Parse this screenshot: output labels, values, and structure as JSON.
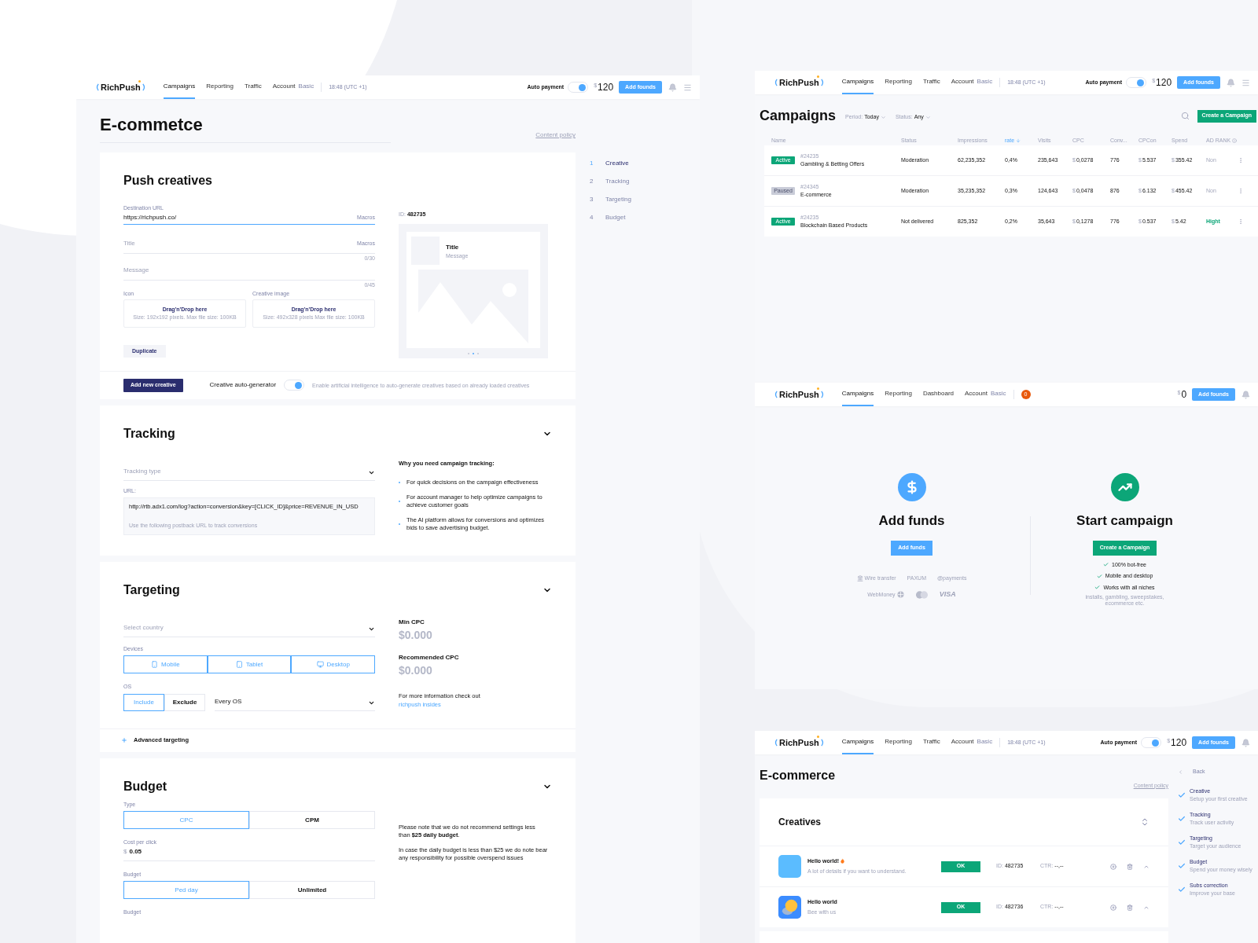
{
  "editor": {
    "nav": {
      "logo": "RichPush",
      "tabs": [
        {
          "label": "Campaigns",
          "selected": true
        },
        {
          "label": "Reporting",
          "selected": false
        },
        {
          "label": "Traffic",
          "selected": false
        },
        {
          "label": "Account",
          "selected": false
        }
      ],
      "plan": "Basic",
      "time": "18:48 (UTC +1)",
      "auto_payment": {
        "label": "Auto payment",
        "on": true
      },
      "balance": {
        "currency": "$",
        "amount": "120"
      },
      "add_button": "Add founds"
    },
    "title": "E-commetce",
    "content_policy": "Content policy",
    "steps": [
      {
        "number": "1",
        "label": "Creative",
        "selected": true
      },
      {
        "number": "2",
        "label": "Tracking",
        "selected": false
      },
      {
        "number": "3",
        "label": "Targeting",
        "selected": false
      },
      {
        "number": "4",
        "label": "Budget",
        "selected": false
      }
    ],
    "creatives": {
      "heading": "Push creatives",
      "destination": {
        "label": "Destination URL",
        "value": "https://richpush.co/",
        "macros": "Macros"
      },
      "title_field": {
        "placeholder": "Title",
        "macros": "Macros",
        "counter": "0/30"
      },
      "message_field": {
        "placeholder": "Message",
        "counter": "0/45"
      },
      "uploads": [
        {
          "label": "Icon",
          "title": "Drag'n'Drop here",
          "hint": "Size: 192x192 pixels. Max file size: 100KB"
        },
        {
          "label": "Creative image",
          "title": "Drag'n'Drop here",
          "hint": "Size: 492x328 pixels Max file size: 100KB"
        }
      ],
      "duplicate": "Duplicate",
      "preview": {
        "id_label": "ID:",
        "id": "482735",
        "title": "Title",
        "message": "Message"
      },
      "add_button": "Add new creative",
      "autogen": {
        "label": "Creative auto-generator",
        "on": true,
        "description": "Enable artificial intelligence to auto-generate creatives based on already loaded creatives"
      }
    },
    "tracking": {
      "heading": "Tracking",
      "type_placeholder": "Tracking type",
      "url_label": "URL:",
      "url": "http://rtb.adx1.com/log?action=conversion&key=[CLICK_ID]&price=REVENUE_IN_USD",
      "url_hint": "Use the following postback URL to track conversions",
      "why_title": "Why you need campaign tracking:",
      "reasons": [
        "For quick decisions on the campaign effectiveness",
        "For account manager to help optimize campaigns to achieve customer goals",
        "The AI platform allows for conversions and optimizes bids to save advertising budget."
      ]
    },
    "targeting": {
      "heading": "Targeting",
      "country_placeholder": "Select country",
      "devices_label": "Devices",
      "devices": [
        {
          "label": "Mobile",
          "kind": "mobile",
          "selected": true
        },
        {
          "label": "Tablet",
          "kind": "tablet",
          "selected": true
        },
        {
          "label": "Desktop",
          "kind": "desktop",
          "selected": true
        }
      ],
      "os_label": "OS",
      "os_modes": [
        {
          "label": "Include",
          "selected": true
        },
        {
          "label": "Exclude",
          "selected": false
        }
      ],
      "os_value": "Every OS",
      "min_cpc": {
        "label": "Min CPC",
        "value": "$0.000"
      },
      "recommended_cpc": {
        "label": "Recommended CPC",
        "value": "$0.000"
      },
      "info": "For more information check out",
      "link": "richpush insides",
      "advanced": "Advanced targeting"
    },
    "budget": {
      "heading": "Budget",
      "type_label": "Type",
      "types": [
        {
          "label": "CPC",
          "selected": true
        },
        {
          "label": "CPM",
          "selected": false
        }
      ],
      "cost_label": "Cost per click",
      "currency": "$",
      "cost": "0.05",
      "budget_label": "Budget",
      "periods": [
        {
          "label": "Ped day",
          "selected": true
        },
        {
          "label": "Unlimited",
          "selected": false
        }
      ],
      "amount_label": "Budget",
      "notes": [
        "Please note that we do not recommend settings less than **$25 daily budget**.",
        "In case the daily budget is less than $25 we do note bear any responsibility for possible overspend issues"
      ]
    }
  },
  "campaigns": {
    "nav": {
      "logo": "RichPush",
      "tabs": [
        {
          "label": "Campaigns",
          "selected": true
        },
        {
          "label": "Reporting",
          "selected": false
        },
        {
          "label": "Traffic",
          "selected": false
        },
        {
          "label": "Account",
          "selected": false
        }
      ],
      "plan": "Basic",
      "time": "18:48 (UTC +1)",
      "auto_payment": {
        "label": "Auto payment",
        "on": true
      },
      "balance": {
        "currency": "$",
        "amount": "120"
      },
      "add_button": "Add founds"
    },
    "heading": "Campaigns",
    "filters": [
      {
        "label": "Period:",
        "value": "Today"
      },
      {
        "label": "Status:",
        "value": "Any"
      }
    ],
    "create_button": "Create a Campaign",
    "columns": [
      {
        "label": "Name",
        "sorted": false
      },
      {
        "label": "Status",
        "sorted": false
      },
      {
        "label": "Impressions",
        "sorted": false
      },
      {
        "label": "rate",
        "sorted": true
      },
      {
        "label": "Visits",
        "sorted": false
      },
      {
        "label": "CPC",
        "sorted": false
      },
      {
        "label": "Conv...",
        "sorted": false
      },
      {
        "label": "CPCon",
        "sorted": false
      },
      {
        "label": "Spend",
        "sorted": false
      },
      {
        "label": "AD RANK",
        "sorted": false
      }
    ],
    "rows": [
      {
        "cells": [
          {
            "badge": {
              "label": "Active",
              "kind": "active"
            },
            "id": "#24235",
            "text": "Gambling & Betting Offers"
          },
          {
            "text": "Moderation"
          },
          {
            "text": "62,235,352"
          },
          {
            "text": "0,4%"
          },
          {
            "text": "235,643"
          },
          {
            "currency": "$",
            "text": "0,0278"
          },
          {
            "text": "776"
          },
          {
            "currency": "$",
            "text": "5.537"
          },
          {
            "currency": "$",
            "text": "355.42"
          },
          {
            "text": "Non",
            "kind": "none"
          }
        ]
      },
      {
        "cells": [
          {
            "badge": {
              "label": "Paused",
              "kind": "paused"
            },
            "id": "#24345",
            "text": "E-commerce"
          },
          {
            "text": "Moderation"
          },
          {
            "text": "35,235,352"
          },
          {
            "text": "0,3%"
          },
          {
            "text": "124,643"
          },
          {
            "currency": "$",
            "text": "0,0478"
          },
          {
            "text": "876"
          },
          {
            "currency": "$",
            "text": "6.132"
          },
          {
            "currency": "$",
            "text": "455.42"
          },
          {
            "text": "Non",
            "kind": "none"
          }
        ]
      },
      {
        "cells": [
          {
            "badge": {
              "label": "Active",
              "kind": "active"
            },
            "id": "#24235",
            "text": "Blockchain Based Products"
          },
          {
            "text": "Not delivered"
          },
          {
            "text": "825,352"
          },
          {
            "text": "0,2%"
          },
          {
            "text": "35,643"
          },
          {
            "currency": "$",
            "text": "0,1278"
          },
          {
            "text": "776"
          },
          {
            "currency": "$",
            "text": "0.537"
          },
          {
            "currency": "$",
            "text": "5.42"
          },
          {
            "text": "Hight",
            "kind": "high"
          }
        ]
      }
    ]
  },
  "dashboard": {
    "nav": {
      "logo": "RichPush",
      "tabs": [
        {
          "label": "Campaigns",
          "selected": true
        },
        {
          "label": "Reporting",
          "selected": false
        },
        {
          "label": "Dashboard",
          "selected": false
        },
        {
          "label": "Account",
          "selected": false
        }
      ],
      "plan": "Basic",
      "notifications": "0",
      "balance": {
        "currency": "$",
        "amount": "0"
      },
      "add_button": "Add founds"
    },
    "funds": {
      "title": "Add funds",
      "button": "Add funds",
      "methods": [
        "Wire transfer",
        "PAXUM",
        "@payments",
        "WebMoney",
        "VISA"
      ]
    },
    "start": {
      "title": "Start campaign",
      "button": "Create a Campaign",
      "features": [
        "100% bot-free",
        "Mobile and desktop",
        "Works with all niches"
      ],
      "note": "installs, gambling, sweepstakes, ecommerce etc."
    }
  },
  "ecommerce": {
    "nav": {
      "logo": "RichPush",
      "tabs": [
        {
          "label": "Campaigns",
          "selected": true
        },
        {
          "label": "Reporting",
          "selected": false
        },
        {
          "label": "Traffic",
          "selected": false
        },
        {
          "label": "Account",
          "selected": false
        }
      ],
      "plan": "Basic",
      "time": "18:48 (UTC +1)",
      "auto_payment": {
        "label": "Auto payment",
        "on": true
      },
      "balance": {
        "currency": "$",
        "amount": "120"
      },
      "add_button": "Add founds"
    },
    "title": "E-commerce",
    "content_policy": "Content policy",
    "back": "Back",
    "heading": "Creatives",
    "steps": [
      {
        "label": "Creative",
        "hint": "Setup your first creative",
        "done": true
      },
      {
        "label": "Tracking",
        "hint": "Track user activity",
        "done": true
      },
      {
        "label": "Targeting",
        "hint": "Target your audience",
        "done": true
      },
      {
        "label": "Budget",
        "hint": "Spend your money wisely",
        "done": true
      },
      {
        "label": "Subs correction",
        "hint": "Improve your base",
        "done": true
      }
    ],
    "creatives": [
      {
        "kind": "plain",
        "hot": true,
        "title": "Hello world!",
        "description": "A lot of details if you want to understand.",
        "status": "OK",
        "id_label": "ID:",
        "id": "482735",
        "ctr_label": "CTR:",
        "ctr": "--,--"
      },
      {
        "kind": "chat",
        "hot": false,
        "title": "Hello world",
        "description": "Bee with us",
        "status": "OK",
        "id_label": "ID:",
        "id": "482736",
        "ctr_label": "CTR:",
        "ctr": "--,--"
      }
    ]
  }
}
